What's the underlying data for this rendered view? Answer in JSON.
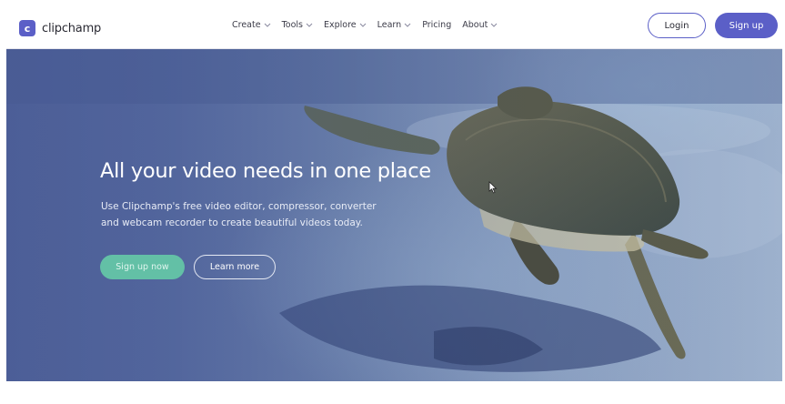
{
  "brand": {
    "logo_letter": "c",
    "name": "clipchamp",
    "color": "#5b5fc7"
  },
  "nav": {
    "items": [
      {
        "label": "Create",
        "has_dropdown": true
      },
      {
        "label": "Tools",
        "has_dropdown": true
      },
      {
        "label": "Explore",
        "has_dropdown": true
      },
      {
        "label": "Learn",
        "has_dropdown": true
      },
      {
        "label": "Pricing",
        "has_dropdown": false
      },
      {
        "label": "About",
        "has_dropdown": true
      }
    ],
    "dropdown_icon": "chevron-down-icon"
  },
  "header_actions": {
    "login_label": "Login",
    "signup_label": "Sign up"
  },
  "hero": {
    "title": "All your video needs in one place",
    "subtitle_line1": "Use Clipchamp's free video editor, compressor, converter",
    "subtitle_line2": "and webcam recorder to create beautiful videos today.",
    "primary_cta": "Sign up now",
    "secondary_cta": "Learn more",
    "background_image": "sea turtle swimming over sandy seabed",
    "primary_cta_color": "#63c0a6"
  }
}
